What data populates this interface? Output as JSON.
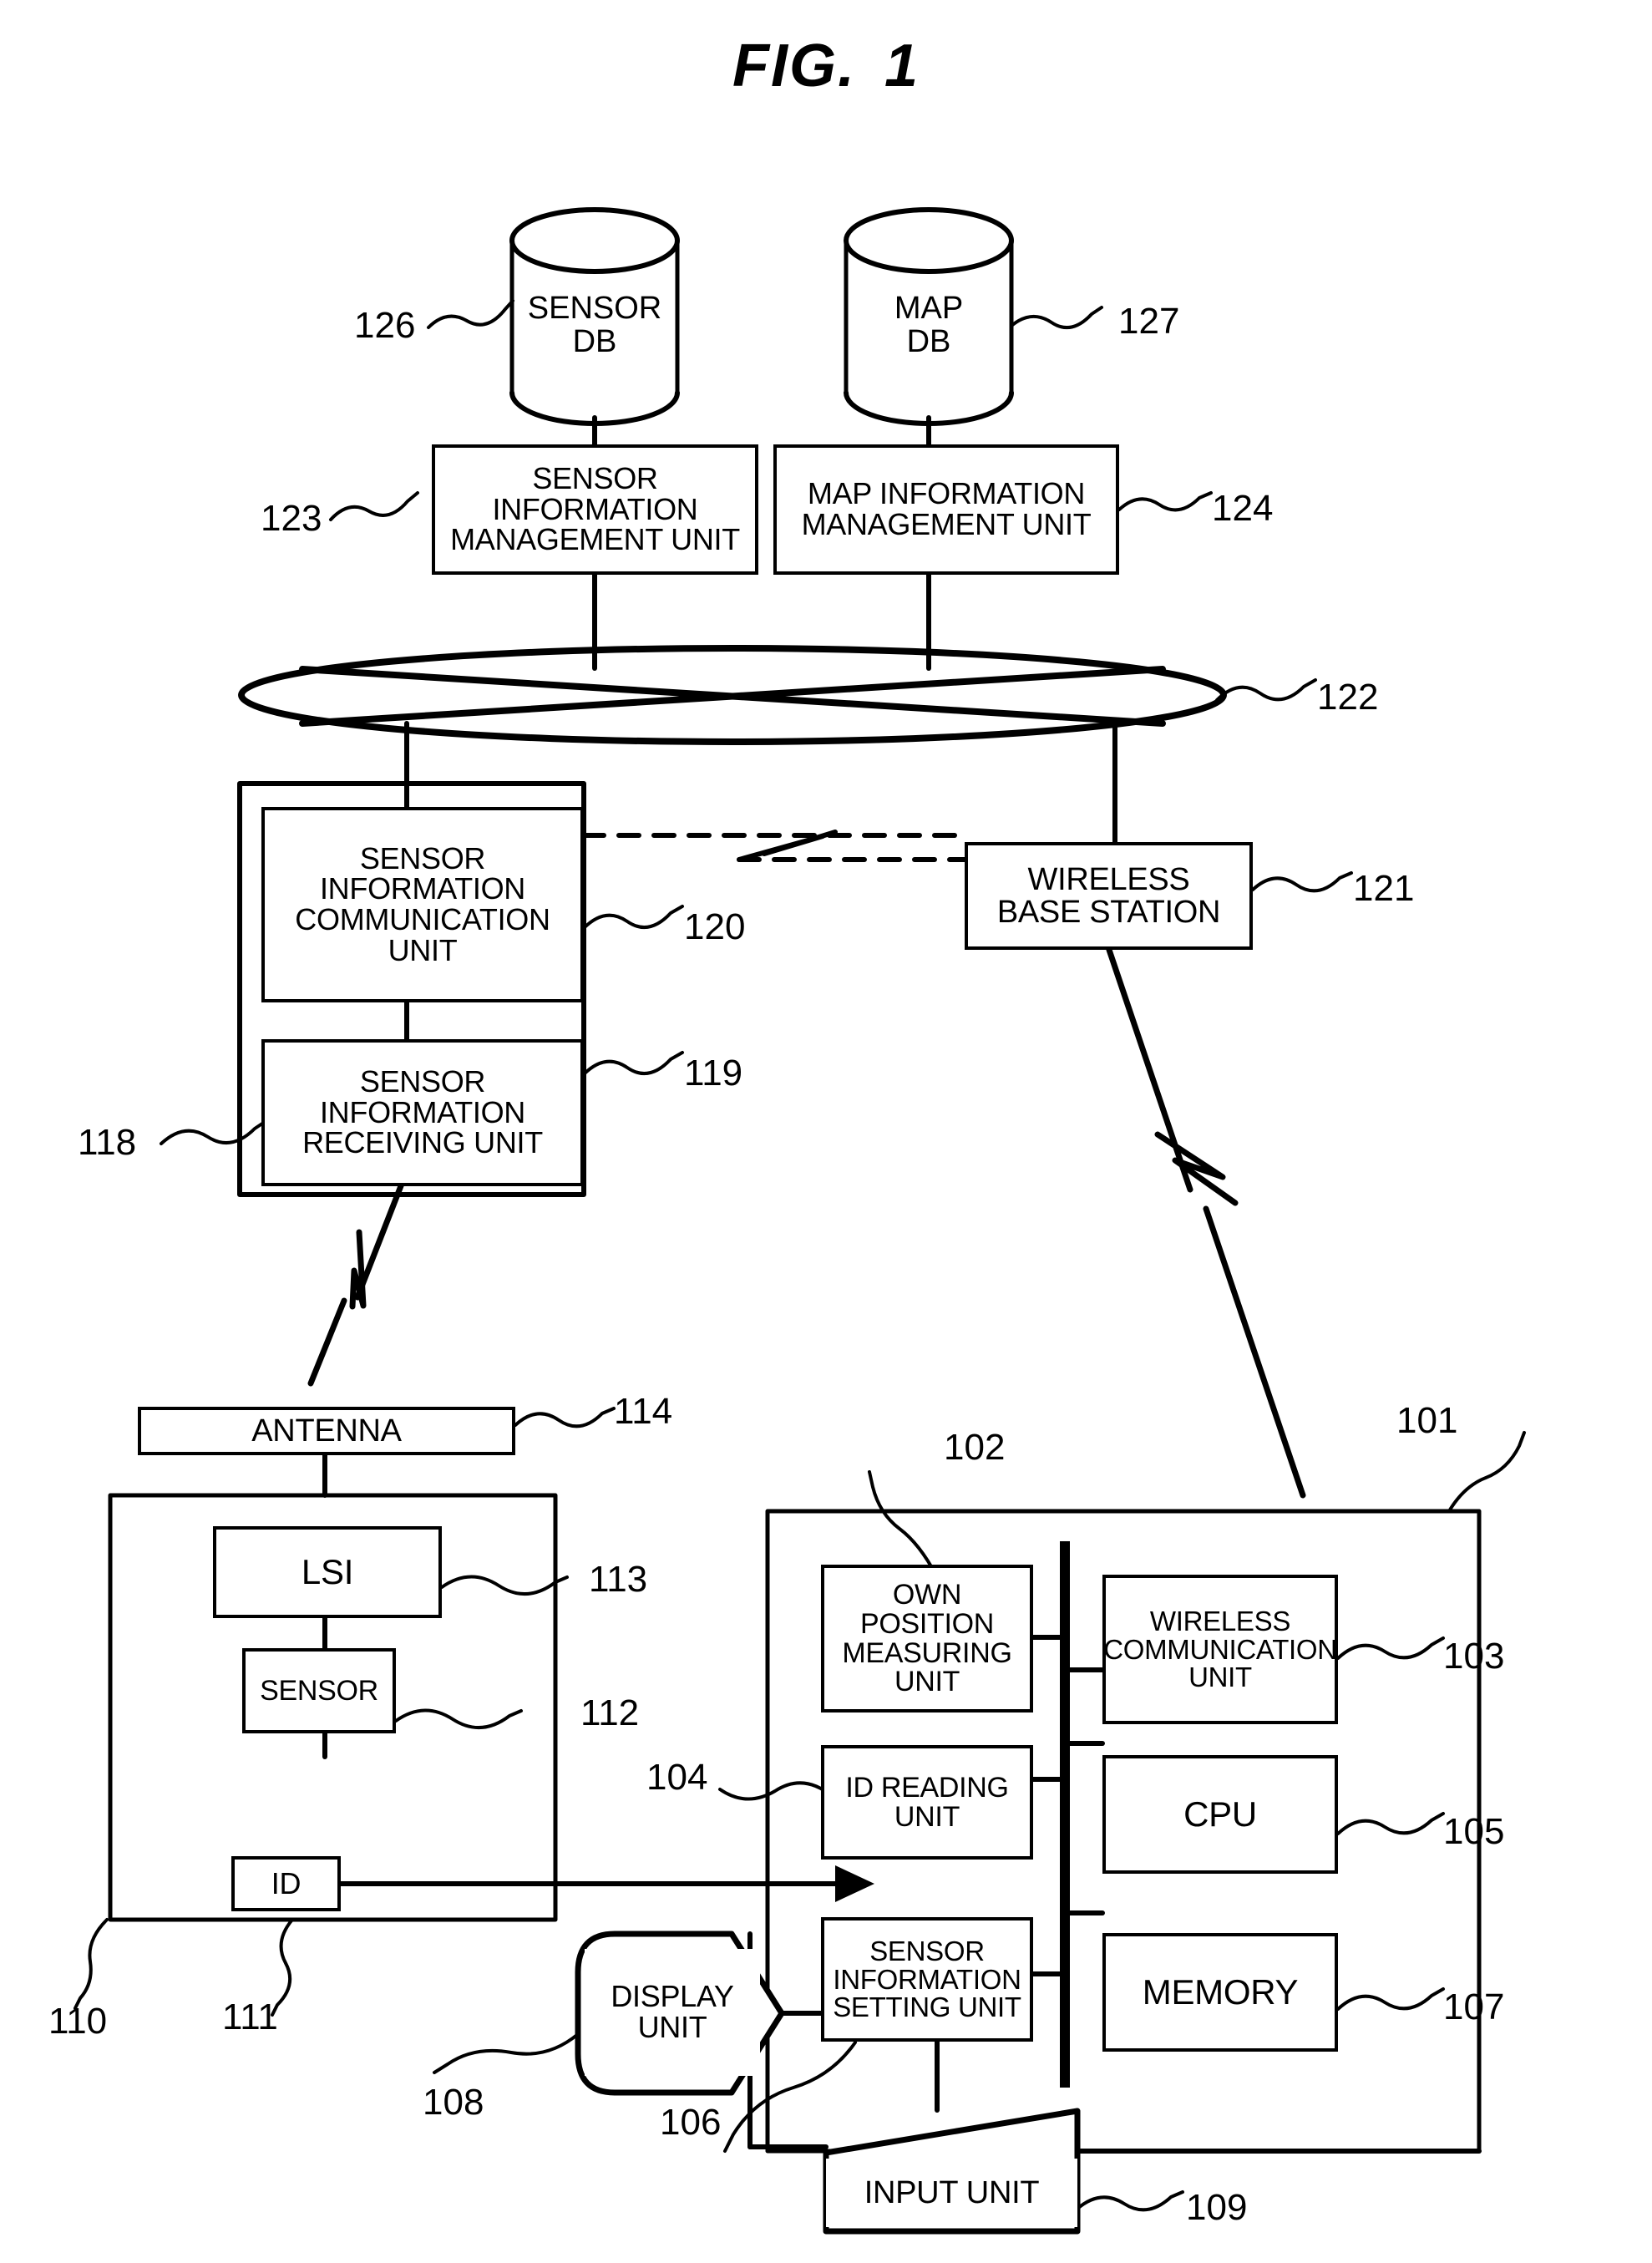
{
  "figure": {
    "title_main": "FIG.",
    "title_number": "1"
  },
  "databases": [
    {
      "id": "sensor-db",
      "line1": "SENSOR",
      "line2": "DB",
      "ref": "126"
    },
    {
      "id": "map-db",
      "line1": "MAP",
      "line2": "DB",
      "ref": "127"
    }
  ],
  "server_units": [
    {
      "id": "sensor-info-management-unit",
      "lines": [
        "SENSOR",
        "INFORMATION",
        "MANAGEMENT UNIT"
      ],
      "ref": "123"
    },
    {
      "id": "map-info-management-unit",
      "lines": [
        "MAP INFORMATION",
        "MANAGEMENT UNIT"
      ],
      "ref": "124"
    }
  ],
  "network": {
    "id": "network-cloud",
    "ref": "122"
  },
  "base_station": {
    "id": "wireless-base-station",
    "lines": [
      "WIRELESS",
      "BASE STATION"
    ],
    "ref": "121"
  },
  "gateway": {
    "id": "sensor-gateway",
    "ref": "118",
    "children": [
      {
        "id": "sensor-info-communication-unit",
        "lines": [
          "SENSOR",
          "INFORMATION",
          "COMMUNICATION",
          "UNIT"
        ],
        "ref": "120"
      },
      {
        "id": "sensor-info-receiving-unit",
        "lines": [
          "SENSOR",
          "INFORMATION",
          "RECEIVING UNIT"
        ],
        "ref": "119"
      }
    ]
  },
  "sensor_node": {
    "id": "sensor-node",
    "ref": "110",
    "antenna": {
      "label": "ANTENNA",
      "ref": "114"
    },
    "lsi": {
      "label": "LSI",
      "ref": "113"
    },
    "sensor": {
      "label": "SENSOR",
      "ref": "112"
    },
    "id_tag": {
      "label": "ID",
      "ref": "111"
    }
  },
  "terminal": {
    "id": "terminal-device",
    "ref": "101",
    "left_column": [
      {
        "id": "own-position-measuring-unit",
        "lines": [
          "OWN POSITION",
          "MEASURING",
          "UNIT"
        ],
        "ref": "102"
      },
      {
        "id": "id-reading-unit",
        "lines": [
          "ID READING",
          "UNIT"
        ],
        "ref": "104"
      },
      {
        "id": "sensor-info-setting-unit",
        "lines": [
          "SENSOR",
          "INFORMATION",
          "SETTING UNIT"
        ],
        "ref": "106"
      }
    ],
    "right_column": [
      {
        "id": "wireless-communication-unit",
        "lines": [
          "WIRELESS",
          "COMMUNICATION",
          "UNIT"
        ],
        "ref": "103"
      },
      {
        "id": "cpu",
        "lines": [
          "CPU"
        ],
        "ref": "105"
      },
      {
        "id": "memory",
        "lines": [
          "MEMORY"
        ],
        "ref": "107"
      }
    ],
    "display_unit": {
      "lines": [
        "DISPLAY",
        "UNIT"
      ],
      "ref": "108"
    },
    "input_unit": {
      "lines": [
        "INPUT UNIT"
      ],
      "ref": "109"
    }
  },
  "colors": {
    "ink": "#000000",
    "paper": "#ffffff"
  }
}
